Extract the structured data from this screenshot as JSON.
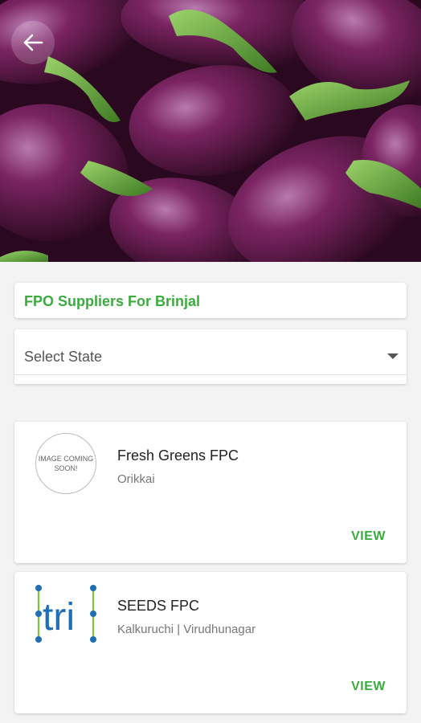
{
  "header": {
    "back_icon": "arrow-left-icon"
  },
  "section_title": "FPO Suppliers For Brinjal",
  "state_select": {
    "value": "Select State",
    "icon": "caret-down-icon"
  },
  "suppliers": [
    {
      "name": "Fresh Greens FPC",
      "location": "Orikkai",
      "logo_text": "IMAGE COMING SOON!",
      "view_label": "VIEW"
    },
    {
      "name": "SEEDS FPC",
      "location": "Kalkuruchi | Virudhunagar",
      "logo_text": "tri",
      "view_label": "VIEW"
    }
  ],
  "colors": {
    "accent_green": "#3aab3d",
    "logo_blue": "#1e6fb5"
  }
}
